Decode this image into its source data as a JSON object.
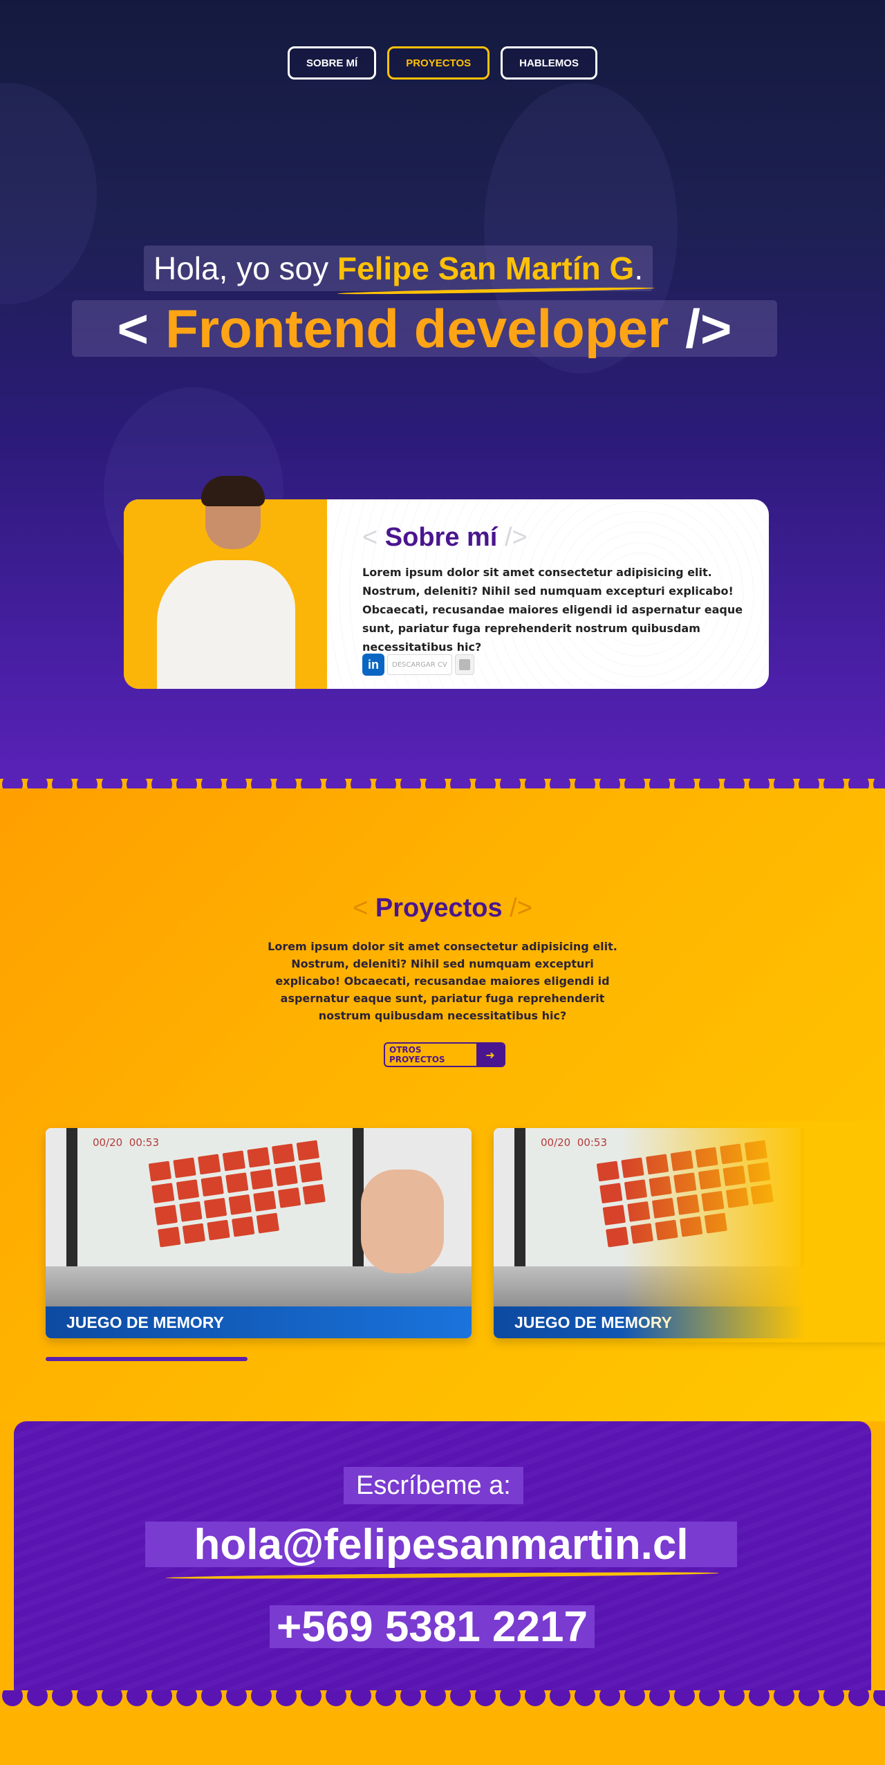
{
  "nav": {
    "items": [
      {
        "label": "SOBRE MÍ"
      },
      {
        "label": "PROYECTOS"
      },
      {
        "label": "HABLEMOS"
      }
    ]
  },
  "hero": {
    "greeting": "Hola, yo soy ",
    "name": "Felipe San Martín G",
    "dot": ".",
    "role_open": "<",
    "role": "Frontend developer",
    "role_close": "/>"
  },
  "about": {
    "bracket_open": "<",
    "title": "Sobre mí",
    "bracket_close": "/>",
    "text": "Lorem ipsum dolor sit amet consectetur adipisicing elit. Nostrum, deleniti? Nihil sed numquam excepturi explicabo! Obcaecati, recusandae maiores eligendi id aspernatur eaque sunt, pariatur fuga reprehenderit nostrum quibusdam necessitatibus hic?",
    "linkedin_icon": "linkedin-icon",
    "cv_label": "DESCARGAR CV",
    "save_icon": "save-icon"
  },
  "projects": {
    "bracket_open": "<",
    "title": "Proyectos",
    "bracket_close": "/>",
    "text": "Lorem ipsum dolor sit amet consectetur adipisicing elit. Nostrum, deleniti? Nihil sed numquam excepturi explicabo! Obcaecati, recusandae maiores eligendi id aspernatur eaque sunt, pariatur fuga reprehenderit nostrum quibusdam necessitatibus hic?",
    "other_button": "OTROS PROYECTOS",
    "other_button_icon": "arrow-right-icon",
    "cards": [
      {
        "title": "JUEGO DE MEMORY",
        "timer_left": "00/20",
        "timer_right": "00:53"
      },
      {
        "title": "JUEGO DE MEMORY",
        "timer_left": "00/20",
        "timer_right": "00:53"
      }
    ]
  },
  "contact": {
    "label": "Escríbeme a:",
    "email": "hola@felipesanmartin.cl",
    "phone": "+569 5381 2217"
  },
  "colors": {
    "accent": "#ffc107",
    "purple": "#4a168f",
    "contact_bg": "#5a14b2"
  }
}
